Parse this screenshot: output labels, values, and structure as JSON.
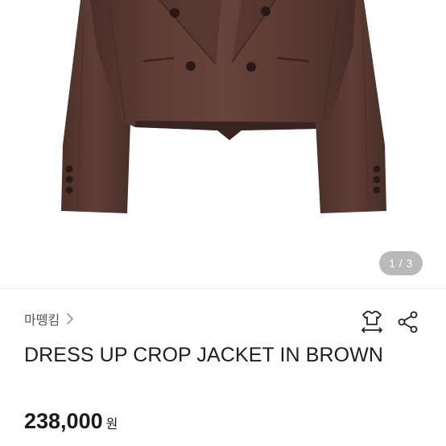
{
  "gallery": {
    "image_alt": "brown double-breasted cropped jacket",
    "page_indicator": "1 / 3",
    "colors": {
      "jacket": "#5b3a33",
      "jacket_dark": "#432925",
      "lining": "#3a2420",
      "button": "#2a1916"
    }
  },
  "store": {
    "name": "마뗑킴",
    "chevron_icon": "chevron-right-icon"
  },
  "actions": {
    "size_icon": "size-guide-shirt-icon",
    "share_icon": "share-icon"
  },
  "product": {
    "title": "DRESS UP CROP JACKET IN BROWN"
  },
  "price": {
    "amount": "238,000",
    "currency": "원"
  }
}
